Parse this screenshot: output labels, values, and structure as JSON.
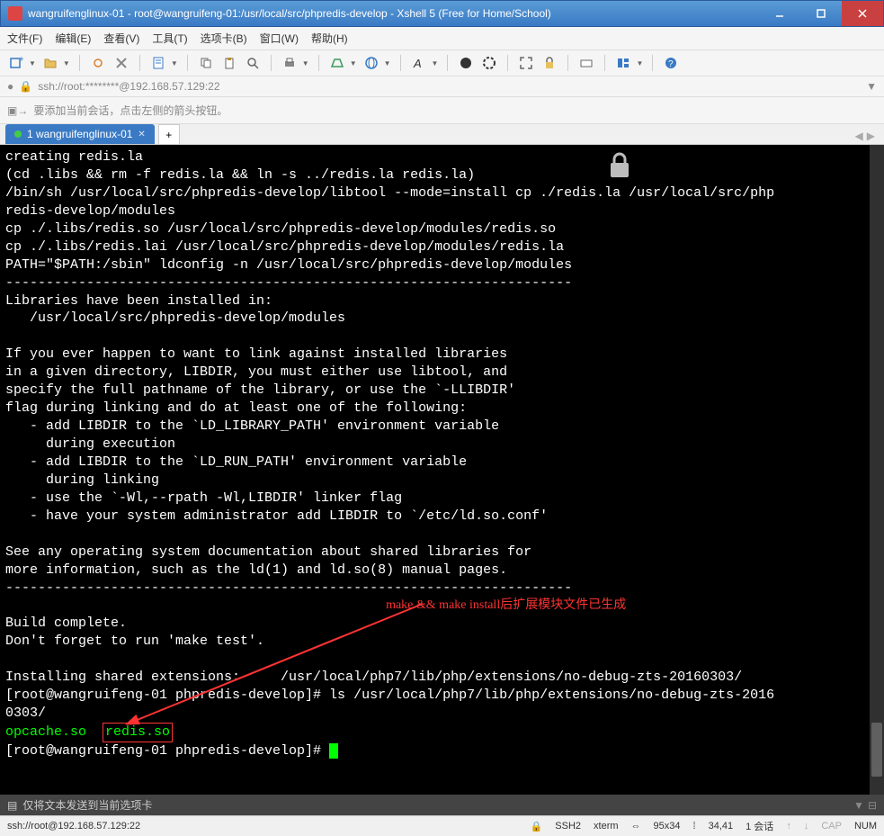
{
  "window": {
    "title": "wangruifenglinux-01 - root@wangruifeng-01:/usr/local/src/phpredis-develop - Xshell 5 (Free for Home/School)"
  },
  "menus": {
    "items": [
      "文件(F)",
      "编辑(E)",
      "查看(V)",
      "工具(T)",
      "选项卡(B)",
      "窗口(W)",
      "帮助(H)"
    ]
  },
  "address": {
    "value": "ssh://root:********@192.168.57.129:22"
  },
  "tip": {
    "text": "要添加当前会话，点击左侧的箭头按钮。"
  },
  "tab": {
    "label": "1 wangruifenglinux-01"
  },
  "terminal": {
    "l01": "creating redis.la",
    "l02": "(cd .libs && rm -f redis.la && ln -s ../redis.la redis.la)",
    "l03": "/bin/sh /usr/local/src/phpredis-develop/libtool --mode=install cp ./redis.la /usr/local/src/php",
    "l04": "redis-develop/modules",
    "l05": "cp ./.libs/redis.so /usr/local/src/phpredis-develop/modules/redis.so",
    "l06": "cp ./.libs/redis.lai /usr/local/src/phpredis-develop/modules/redis.la",
    "l07": "PATH=\"$PATH:/sbin\" ldconfig -n /usr/local/src/phpredis-develop/modules",
    "dash": "----------------------------------------------------------------------",
    "l08": "Libraries have been installed in:",
    "l09": "   /usr/local/src/phpredis-develop/modules",
    "l10": "If you ever happen to want to link against installed libraries",
    "l11": "in a given directory, LIBDIR, you must either use libtool, and",
    "l12": "specify the full pathname of the library, or use the `-LLIBDIR'",
    "l13": "flag during linking and do at least one of the following:",
    "l14": "   - add LIBDIR to the `LD_LIBRARY_PATH' environment variable",
    "l15": "     during execution",
    "l16": "   - add LIBDIR to the `LD_RUN_PATH' environment variable",
    "l17": "     during linking",
    "l18": "   - use the `-Wl,--rpath -Wl,LIBDIR' linker flag",
    "l19": "   - have your system administrator add LIBDIR to `/etc/ld.so.conf'",
    "l20": "See any operating system documentation about shared libraries for",
    "l21": "more information, such as the ld(1) and ld.so(8) manual pages.",
    "l22": "Build complete.",
    "l23": "Don't forget to run 'make test'.",
    "l24a": "Installing shared extensions:     /usr/local/php7/lib/php/extensions/no-debug-zts-20160303/",
    "l25": "[root@wangruifeng-01 phpredis-develop]# ls /usr/local/php7/lib/php/extensions/no-debug-zts-2016",
    "l26": "0303/",
    "out1": "opcache.so",
    "out2": "redis.so",
    "prompt": "[root@wangruifeng-01 phpredis-develop]# ",
    "annotation": "make && make install后扩展模块文件已生成"
  },
  "quickbar": {
    "text": "仅将文本发送到当前选项卡"
  },
  "status": {
    "conn": "ssh://root@192.168.57.129:22",
    "ssh": "SSH2",
    "term": "xterm",
    "size": "95x34",
    "pos": "34,41",
    "sessions": "1 会话",
    "cap": "CAP",
    "num": "NUM"
  }
}
